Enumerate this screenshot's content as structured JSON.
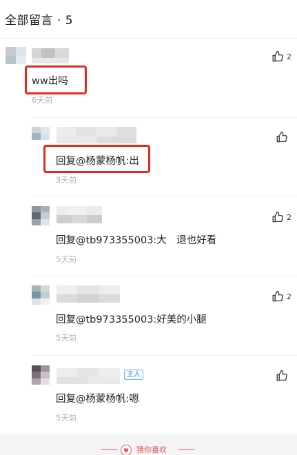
{
  "header": {
    "title": "全部留言 · 5"
  },
  "comments": [
    {
      "content": "ww出吗",
      "time": "6天前",
      "likes": "2",
      "highlighted": true
    },
    {
      "content": "回复@杨蒙杨帆:出",
      "time": "3天前",
      "likes": "",
      "highlighted": true
    },
    {
      "content": "回复@tb973355003:大　退也好看",
      "time": "5天前",
      "likes": "2",
      "highlighted": false
    },
    {
      "content": "回复@tb973355003:好美的小腿",
      "time": "5天前",
      "likes": "2",
      "highlighted": false
    },
    {
      "content": "回复@杨蒙杨帆:嗯",
      "time": "5天前",
      "likes": "",
      "highlighted": false,
      "owner_badge": "主人"
    }
  ],
  "footer": {
    "label": "猜你喜欢"
  },
  "icons": {
    "like": "thumbs-up-icon",
    "heart": "heart-icon"
  },
  "colors": {
    "highlight": "#e8271e",
    "accent": "#e85a5a",
    "badge": "#4a90d9"
  }
}
